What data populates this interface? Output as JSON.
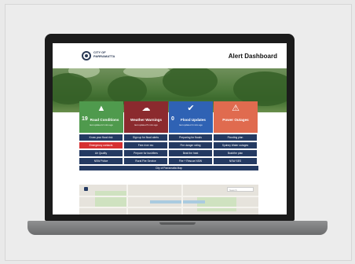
{
  "header": {
    "logo_text": "CITY OF PARRAMATTA",
    "title": "Alert Dashboard"
  },
  "tiles": [
    {
      "number": "19",
      "name": "Road Conditions",
      "subtitle": "last updated 2 mins ago",
      "icon": "road-icon",
      "color": "#4f9a4d",
      "glyph": "▲"
    },
    {
      "number": "",
      "name": "Weather Warnings",
      "subtitle": "last updated 5 mins ago",
      "icon": "cloud-icon",
      "color": "#8b2a2e",
      "glyph": "☁"
    },
    {
      "number": "0",
      "name": "Flood Updates",
      "subtitle": "last updated 4 mins ago",
      "icon": "check-icon",
      "color": "#2f62b4",
      "glyph": "✔"
    },
    {
      "number": "",
      "name": "Power Outages",
      "subtitle": "",
      "icon": "warning-icon",
      "color": "#e06b4f",
      "glyph": "⚠"
    }
  ],
  "buttons": [
    [
      "Know your flood risk",
      "Sign up for flood alerts",
      "Preparing for floods",
      "Flooding plan"
    ],
    [
      "Emergency contacts",
      "Free river rec",
      "Fire danger rating",
      "Sydney Water outages"
    ],
    [
      "Air Quality",
      "Prepare for bushfires",
      "Beat the heat",
      "Bushfire plan"
    ],
    [
      "NSW Police",
      "Rural Fire Service",
      "Fire + Rescue NSW",
      "NSW SES"
    ]
  ],
  "wide_button": "City of Parramatta Map",
  "map": {
    "search_placeholder": "Search"
  },
  "colors": {
    "navy": "#243a62",
    "emergency_red": "#d63031"
  }
}
